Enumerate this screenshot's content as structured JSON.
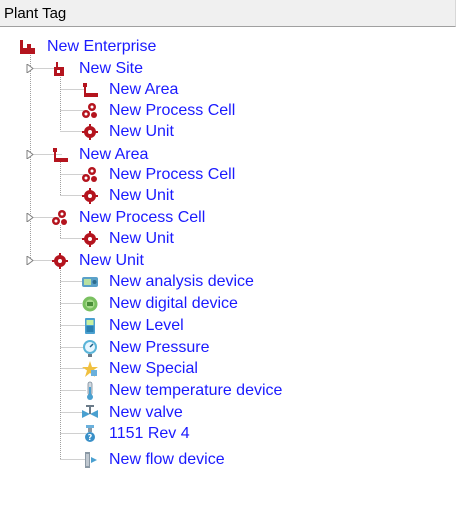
{
  "header": {
    "title": "Plant Tag"
  },
  "tree": {
    "nodes": [
      {
        "label": "New Enterprise",
        "icon": "enterprise-icon",
        "level": 0
      },
      {
        "label": "New Site",
        "icon": "site-icon",
        "level": 1,
        "expander": true
      },
      {
        "label": "New Area",
        "icon": "area-icon",
        "level": 2
      },
      {
        "label": "New Process Cell",
        "icon": "process-cell-icon",
        "level": 2
      },
      {
        "label": "New Unit",
        "icon": "unit-icon",
        "level": 2
      },
      {
        "label": "New Area",
        "icon": "area-icon",
        "level": 1,
        "expander": true
      },
      {
        "label": "New Process Cell",
        "icon": "process-cell-icon",
        "level": 2
      },
      {
        "label": "New Unit",
        "icon": "unit-icon",
        "level": 2
      },
      {
        "label": "New Process Cell",
        "icon": "process-cell-icon",
        "level": 1,
        "expander": true
      },
      {
        "label": "New Unit",
        "icon": "unit-icon",
        "level": 2
      },
      {
        "label": "New Unit",
        "icon": "unit-icon",
        "level": 1,
        "expander": true
      },
      {
        "label": "New analysis device",
        "icon": "analysis-device-icon",
        "level": 2
      },
      {
        "label": "New digital device",
        "icon": "digital-device-icon",
        "level": 2
      },
      {
        "label": "New Level",
        "icon": "level-device-icon",
        "level": 2
      },
      {
        "label": "New Pressure",
        "icon": "pressure-device-icon",
        "level": 2
      },
      {
        "label": "New Special",
        "icon": "special-device-icon",
        "level": 2
      },
      {
        "label": "New temperature device",
        "icon": "temperature-device-icon",
        "level": 2
      },
      {
        "label": "New valve",
        "icon": "valve-icon",
        "level": 2
      },
      {
        "label": "1151 Rev 4",
        "icon": "transmitter-1151-icon",
        "level": 2
      },
      {
        "label": "New flow device",
        "icon": "flow-device-icon",
        "level": 2
      }
    ]
  },
  "colors": {
    "label": "#1a1aff",
    "tree_line": "#a0a0a0",
    "header_bg": "#f0f0f0",
    "icon_red": "#b4141e"
  }
}
